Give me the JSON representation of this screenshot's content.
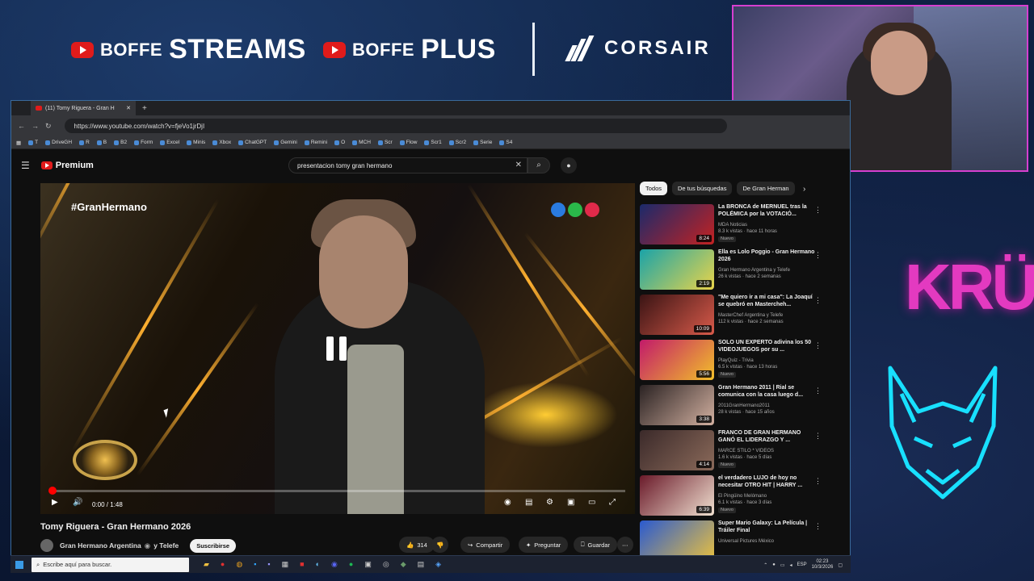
{
  "overlay": {
    "brand1_small": "BOFFE",
    "brand1_big": "STREAMS",
    "brand2_small": "BOFFE",
    "brand2_big": "PLUS",
    "sponsor": "CORSAIR",
    "side_logo": "KRÜ",
    "colors": {
      "accent_pink": "#e33ac0",
      "accent_cyan": "#18e0ff",
      "youtube_red": "#e01b1b"
    }
  },
  "browser": {
    "tab_title": "(11) Tomy Riguera - Gran H",
    "new_tab": "+",
    "url": "https://www.youtube.com/watch?v=fjeVo1jrDjI",
    "bookmarks": [
      "T",
      "DriveGH",
      "R",
      "B",
      "B2",
      "Form",
      "Excel",
      "Minis",
      "Xbox",
      "ChatGPT",
      "Gemini",
      "Remini",
      "O",
      "MCH",
      "Scr",
      "Flow",
      "Scr1",
      "Scr2",
      "Serie",
      "S4"
    ]
  },
  "youtube": {
    "brand": "Premium",
    "search_value": "presentacion tomy gran hermano",
    "video": {
      "overlay_hashtag": "#GranHermano",
      "time": "0:00 / 1:48",
      "progress_fraction": 0.0,
      "title": "Tomy Riguera - Gran Hermano 2026",
      "channel": "Gran Hermano Argentina",
      "channel_suffix": "y Telefe",
      "subscribe": "Suscribirse",
      "likes": "314",
      "share": "Compartir",
      "ask": "Preguntar",
      "save": "Guardar"
    },
    "chips": [
      "Todos",
      "De tus búsquedas",
      "De Gran Herman"
    ],
    "recommendations": [
      {
        "title": "La BRONCA de MERNUEL tras la POLÉMICA por la VOTACIÓ...",
        "channel": "MDA Noticias",
        "meta": "8.3 k vistas · hace 11 horas",
        "badge": "Nuevo",
        "duration": "8:24",
        "thumb_colors": [
          "#1b2a6b",
          "#c32222"
        ]
      },
      {
        "title": "Ella es Lolo Poggio - Gran Hermano 2026",
        "channel": "Gran Hermano Argentina y Telefe",
        "meta": "26 k vistas · hace 2 semanas",
        "badge": "",
        "duration": "2:19",
        "thumb_colors": [
          "#1aa3a8",
          "#e9d44a"
        ]
      },
      {
        "title": "\"Me quiero ir a mi casa\": La Joaquí se quebró en Mastercheh...",
        "channel": "MasterChef Argentina y Telefe",
        "meta": "112 k vistas · hace 2 semanas",
        "badge": "",
        "duration": "10:09",
        "thumb_colors": [
          "#3a1414",
          "#d85a4a"
        ]
      },
      {
        "title": "SOLO UN EXPERTO adivina los 50 VIDEOJUEGOS por su ...",
        "channel": "PlayQuiz - Trivia",
        "meta": "6.5 k vistas · hace 13 horas",
        "badge": "Nuevo",
        "duration": "5:56",
        "thumb_colors": [
          "#c21a6a",
          "#f2c02a"
        ]
      },
      {
        "title": "Gran Hermano 2011 | Rial se comunica con la casa luego d...",
        "channel": "2011GranHermano2011",
        "meta": "28 k vistas · hace 15 años",
        "badge": "",
        "duration": "3:38",
        "thumb_colors": [
          "#2a2222",
          "#d2b0a0"
        ]
      },
      {
        "title": "FRANCO DE GRAN HERMANO GANÓ EL LIDERAZGO Y ...",
        "channel": "MARCE STILO * VIDEOS",
        "meta": "1.6 k vistas · hace 5 días",
        "badge": "Nuevo",
        "duration": "4:14",
        "thumb_colors": [
          "#3b2a2a",
          "#8b6a5a"
        ]
      },
      {
        "title": "el verdadero LUJO de hoy no necesitar OTRO HIT | HARRY ...",
        "channel": "El Pingüino Melómano",
        "meta": "6.1 k vistas · hace 3 días",
        "badge": "Nuevo",
        "duration": "6:39",
        "thumb_colors": [
          "#6a1a2a",
          "#f0e0d0"
        ]
      },
      {
        "title": "Super Mario Galaxy: La Película | Tráiler Final",
        "channel": "Universal Pictures México",
        "meta": "",
        "badge": "",
        "duration": "",
        "thumb_colors": [
          "#2a5ad0",
          "#e8c040"
        ]
      }
    ]
  },
  "taskbar": {
    "search_placeholder": "Escribe aquí para buscar.",
    "lang": "ESP",
    "time": "02:23",
    "date": "10/3/2026"
  }
}
